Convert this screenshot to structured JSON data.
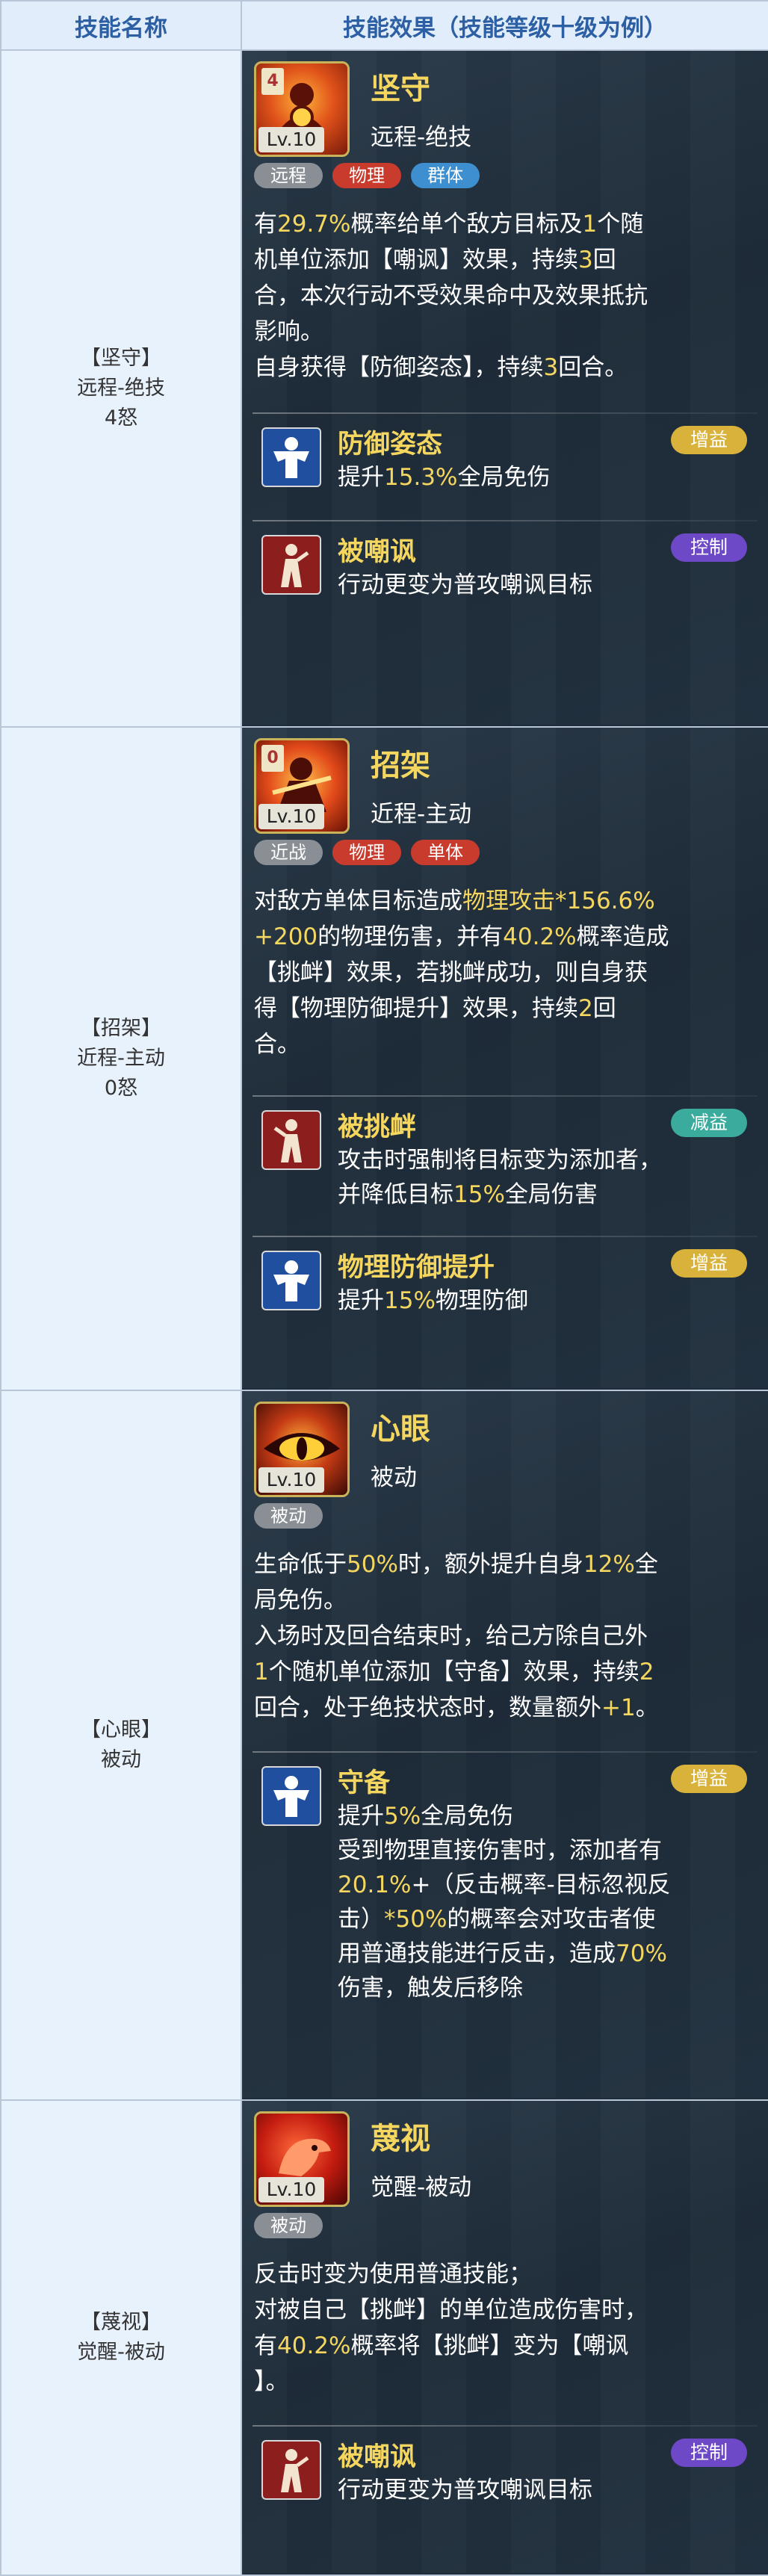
{
  "header": {
    "col_name": "技能名称",
    "col_effect": "技能效果（技能等级十级为例）"
  },
  "skills": [
    {
      "left": [
        "【坚守】",
        "远程-绝技",
        "4怒"
      ],
      "icon_number": "4",
      "level": "Lv.10",
      "name": "坚守",
      "type": "远程-绝技",
      "tags": [
        "远程",
        "物理",
        "群体"
      ],
      "desc": [
        "有<y>29.7%</y>概率给单个敌方目标及<y>1</y>个随",
        "机单位添加【嘲讽】效果，持续<y>3</y>回",
        "合，本次行动不受效果命中及效果抵抗",
        "影响。",
        "自身获得【防御姿态】，持续<y>3</y>回合。"
      ],
      "effects": [
        {
          "name": "防御姿态",
          "badge": "增益",
          "lines": [
            "提升<y>15.3%</y>全局免伤"
          ]
        },
        {
          "name": "被嘲讽",
          "badge": "控制",
          "lines": [
            "行动更变为普攻嘲讽目标"
          ]
        }
      ]
    },
    {
      "left": [
        "【招架】",
        "近程-主动",
        "0怒"
      ],
      "icon_number": "0",
      "level": "Lv.10",
      "name": "招架",
      "type": "近程-主动",
      "tags": [
        "近战",
        "物理",
        "单体"
      ],
      "desc": [
        "对敌方单体目标造成<y>物理攻击*156.6%</y>",
        "<y>+200</y>的物理伤害，并有<y>40.2%</y>概率造成",
        "【挑衅】效果，若挑衅成功，则自身获",
        "得【物理防御提升】效果，持续<y>2</y>回",
        "合。"
      ],
      "effects": [
        {
          "name": "被挑衅",
          "badge": "减益",
          "lines": [
            "攻击时强制将目标变为添加者，",
            "并降低目标<y>15%</y>全局伤害"
          ]
        },
        {
          "name": "物理防御提升",
          "badge": "增益",
          "lines": [
            "提升<y>15%</y>物理防御"
          ]
        }
      ]
    },
    {
      "left": [
        "【心眼】",
        "被动"
      ],
      "level": "Lv.10",
      "name": "心眼",
      "type": "被动",
      "tags": [
        "被动"
      ],
      "desc": [
        "生命低于<y>50%</y>时，额外提升自身<y>12%</y>全",
        "局免伤。",
        "入场时及回合结束时，给己方除自己外",
        "<y>1</y>个随机单位添加【守备】效果，持续<y>2</y>",
        "回合，处于绝技状态时，数量额外<y>+1</y>。"
      ],
      "effects": [
        {
          "name": "守备",
          "badge": "增益",
          "lines": [
            "提升<y>5%</y>全局免伤",
            "受到物理直接伤害时，添加者有",
            "<y>20.1%</y>+（反击概率-目标忽视反",
            "击）<y>*50%</y>的概率会对攻击者使",
            "用普通技能进行反击，造成<y>70%</y>",
            "伤害，触发后移除"
          ]
        }
      ]
    },
    {
      "left": [
        "【蔑视】",
        "觉醒-被动"
      ],
      "level": "Lv.10",
      "name": "蔑视",
      "type": "觉醒-被动",
      "tags": [
        "被动"
      ],
      "desc": [
        "反击时变为使用普通技能；",
        "对被自己【挑衅】的单位造成伤害时，",
        "有<y>40.2%</y>概率将【挑衅】变为【嘲讽",
        "】。"
      ],
      "effects": [
        {
          "name": "被嘲讽",
          "badge": "控制",
          "lines": [
            "行动更变为普攻嘲讽目标"
          ]
        }
      ]
    }
  ],
  "colors": {
    "accent_yellow": "#f5d760",
    "tag_red": "#c93c2d",
    "tag_blue": "#3d8fd0",
    "badge_gold": "#d8b23a",
    "badge_purple": "#6d49c8",
    "badge_teal": "#3aab9d"
  },
  "icons": [
    "shield-fighter-icon",
    "parry-fighter-icon",
    "demon-eye-icon",
    "red-bird-icon",
    "defense-stance-icon",
    "taunted-icon",
    "provoked-icon",
    "guard-icon"
  ]
}
